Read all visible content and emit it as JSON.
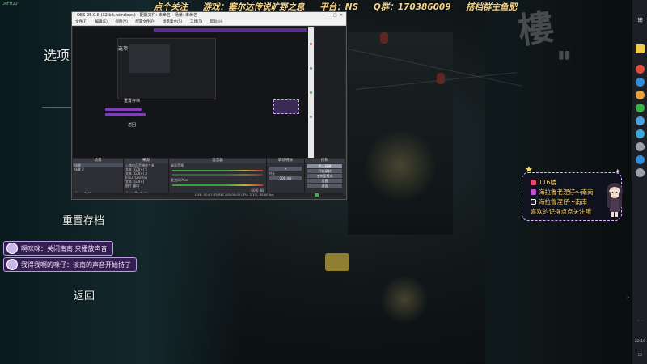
{
  "corner_tag": "DeFH22",
  "top_overlay": {
    "items": [
      "点个关注",
      "游戏：塞尔达传说旷野之息",
      "平台：NS",
      "Q群：170386009",
      "搭档群主鱼肥"
    ]
  },
  "game_menu": {
    "options": "选项",
    "reset_save": "重置存档",
    "back": "返回"
  },
  "chat": [
    {
      "text": "啊咪咪：关闭南南 只播放声音"
    },
    {
      "text": "我得我啊的咪仔：淡南的声音开始持了"
    }
  ],
  "obs": {
    "title": "OBS 25.0.8 (32 bit, windows) - 配置文件: 未命名 - 场景: 未命名",
    "menu": [
      "文件(F)",
      "编辑(E)",
      "视图(V)",
      "配置文件(P)",
      "场景集合(S)",
      "工具(T)",
      "帮助(H)"
    ],
    "docks": {
      "scenes": {
        "header": "场景",
        "items": [
          "场景",
          "场景 2"
        ]
      },
      "sources": {
        "header": "来源",
        "items": [
          "心跳的声音播放工具",
          "文本 (GDI+) 5",
          "文本 (GDI+) 4",
          "Input Overlay",
          "文本 (GDI+)",
          "图片 窗口"
        ]
      },
      "mixer": {
        "header": "混音器",
        "tracks": [
          "桌面音频",
          "麦克风/Aux"
        ],
        "db": "-60.0 dB"
      },
      "transitions": {
        "header": "转场特效",
        "duration": "300 ms",
        "duration_label": "时长"
      },
      "controls": {
        "header": "控制",
        "buttons": [
          "停止直播",
          "开始录制",
          "工作室模式",
          "设置",
          "退出"
        ]
      }
    },
    "status": "LIVE: 00:17:05  REC: 00:00:00  CPU: 2.1%, 60.00 fps",
    "preview_labels": {
      "left_small": "选项",
      "reset": "重置存档",
      "back": "返回"
    }
  },
  "notification": {
    "rows": [
      {
        "text": "116楼",
        "color": "#e84a6a"
      },
      {
        "text": "海拉鲁老涅仔～南南",
        "color": "#c64fd8"
      },
      {
        "text": "海拉鲁涅仔～南南",
        "color": "#222222"
      },
      {
        "text": "喜欢的记得点点关注哦",
        "color": ""
      }
    ]
  },
  "taskbar": {
    "time": "22:16",
    "icon_colors": [
      "#e04b3c",
      "#2f8ee0",
      "#e8a23a",
      "#3bb14a",
      "#4aa3df",
      "#3aa6d8",
      "#9aa3ad",
      "#2f8ee0",
      "#9aa3ad"
    ]
  },
  "colors": {
    "overlay_text": "#f6d48a",
    "chat_bg": "#3c1e5a",
    "accent_purple": "#7d3fb8"
  }
}
